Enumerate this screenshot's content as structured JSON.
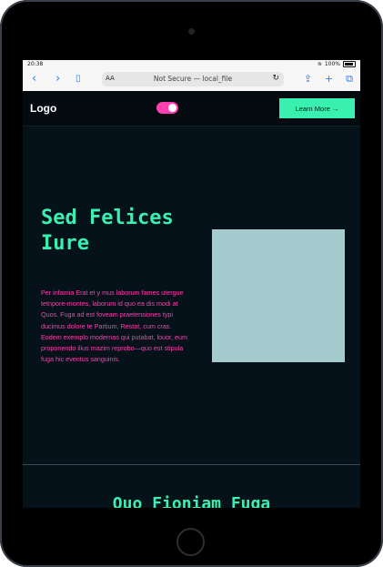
{
  "status": {
    "time": "20:38",
    "battery": "100%"
  },
  "browser": {
    "text_size": "AA",
    "address": "Not Secure — local_file"
  },
  "navbar": {
    "logo": "Logo",
    "cta": "Learn More →",
    "toggle_on": true
  },
  "hero": {
    "headline": "Sed Felices Iure",
    "description": "Per infamia Erat et y mus laborum fames utergue tetnpore-montes, laborum id quo ea dis modi at Quos. Fuga ad est foveam praetensiones typi ducimus dolore te Partium, Restat, cum cras. Eodem exemplo modernas qui putabat, louor, eum proponendo ilius mazim reprobo—quo est stipula fuga hic eventus sanguinis."
  },
  "section": {
    "title": "Quo Fioniam Fuga"
  },
  "colors": {
    "accent": "#3af0b0",
    "pink": "#ff3fae",
    "background": "#06121a",
    "image_placeholder": "#a6cbcf"
  }
}
